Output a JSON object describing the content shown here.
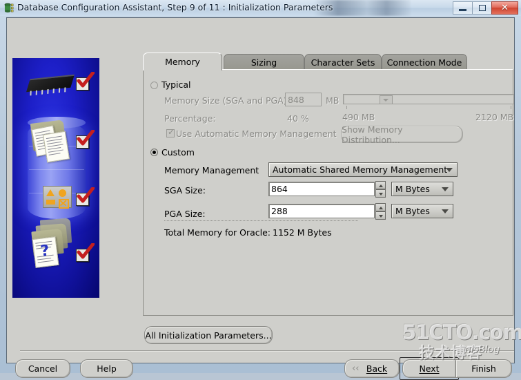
{
  "window": {
    "title": "Database Configuration Assistant, Step 9 of 11 : Initialization Parameters",
    "icon": "oracle-database-icon",
    "controls": {
      "minimize": "minimize-icon",
      "maximize": "maximize-icon",
      "close": "✕"
    }
  },
  "tabs": [
    {
      "label": "Memory",
      "active": true
    },
    {
      "label": "Sizing",
      "active": false
    },
    {
      "label": "Character Sets",
      "active": false
    },
    {
      "label": "Connection Mode",
      "active": false
    }
  ],
  "memory_tab": {
    "typical": {
      "radio_label": "Typical",
      "selected": false,
      "enabled": false,
      "memory_size_label": "Memory Size (SGA and PGA):",
      "memory_size_value": "848",
      "memory_size_unit": "MB",
      "percentage_label": "Percentage:",
      "percentage_value": "40 %",
      "slider_min_label": "490 MB",
      "slider_max_label": "2120 MB",
      "amm_checkbox_label": "Use Automatic Memory Management",
      "amm_checked": true,
      "show_distribution_button": "Show Memory Distribution..."
    },
    "custom": {
      "radio_label": "Custom",
      "selected": true,
      "enabled": true,
      "memory_management_label": "Memory Management",
      "memory_management_value": "Automatic Shared Memory Management",
      "sga_label": "SGA Size:",
      "sga_value": "864",
      "sga_unit": "M Bytes",
      "pga_label": "PGA Size:",
      "pga_value": "288",
      "pga_unit": "M Bytes",
      "total_label": "Total Memory for Oracle:",
      "total_value": "1152 M Bytes"
    }
  },
  "all_params_button": "All Initialization Parameters...",
  "footer": {
    "cancel": "Cancel",
    "help": "Help",
    "back": "Back",
    "next": "Next",
    "finish": "Finish"
  },
  "watermark": {
    "line1": "51CTO.com",
    "line2": "技术博客",
    "line3": "nisBlog"
  },
  "sidebar": {
    "name": "dbca-illustration",
    "checkmarks": 4
  }
}
